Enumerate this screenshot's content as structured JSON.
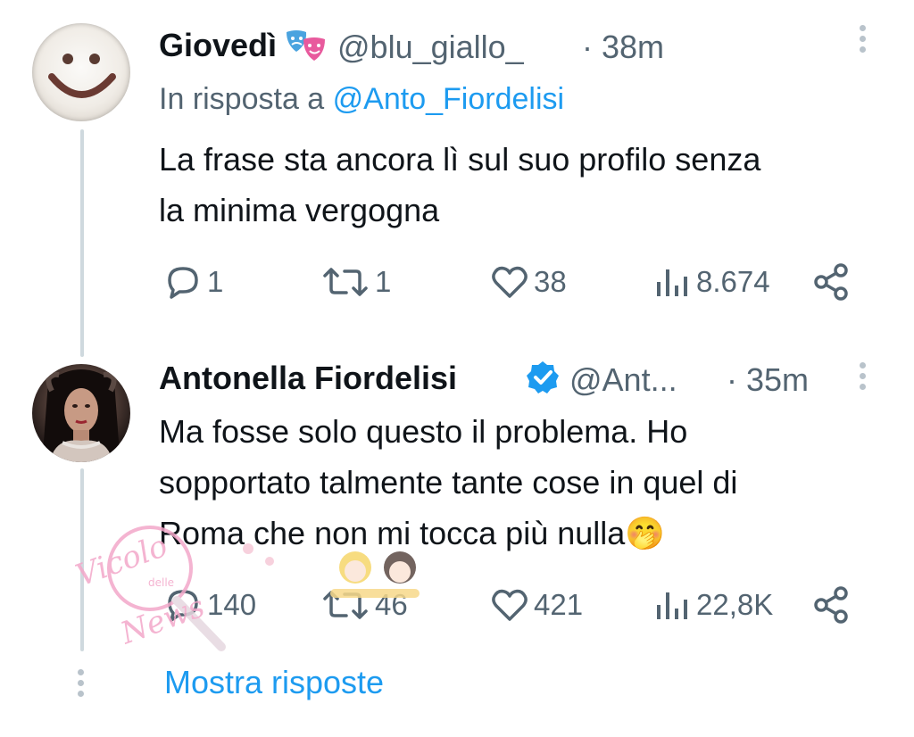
{
  "tweet1": {
    "display_name": "Giovedì",
    "handle": "@blu_giallo_",
    "time": "· 38m",
    "reply_prefix": "In risposta a ",
    "reply_to": "@Anto_Fiordelisi",
    "text_line1": "La frase sta ancora lì sul suo profilo senza",
    "text_line2": "la minima vergogna",
    "replies": "1",
    "retweets": "1",
    "likes": "38",
    "views": "8.674"
  },
  "tweet2": {
    "display_name": "Antonella Fiordelisi",
    "handle": "@Ant...",
    "time": "· 35m",
    "text_line1": "Ma fosse solo questo il problema. Ho",
    "text_line2": "sopportato talmente tante cose in quel di",
    "text_line3": "Roma che non mi tocca più nulla",
    "emoji": "🤭",
    "replies": "140",
    "retweets": "46",
    "likes": "421",
    "views": "22,8K"
  },
  "show_replies_label": "Mostra risposte",
  "watermark": {
    "line1": "Vicolo",
    "line2": "delle",
    "line3": "News",
    "color": "#f3a7c9"
  },
  "colors": {
    "accent": "#1d9bf0",
    "secondary_text": "#536471",
    "thread_line": "#cfd9de"
  }
}
